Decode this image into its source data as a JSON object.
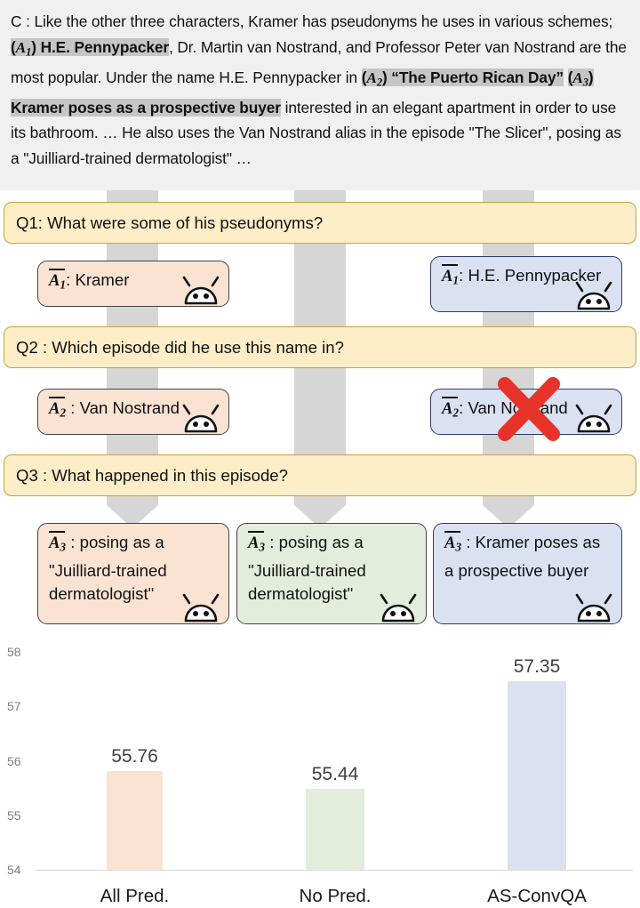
{
  "context": {
    "label": "C :",
    "parts": [
      {
        "t": " Like the other three characters, Kramer has pseudonyms he uses in various schemes; ",
        "hl": false,
        "b": false
      },
      {
        "t": "(A₁) H.E. Pennypacker",
        "hl": true,
        "b": true,
        "math": "A",
        "subscript": "1"
      },
      {
        "t": ", Dr. Martin van Nostrand, and Professor Peter van Nostrand are the most popular. Under the name H.E. Pennypacker in ",
        "hl": false,
        "b": false
      },
      {
        "t": "(A₂) “The Puerto Rican Day”",
        "hl": true,
        "b": true,
        "math": "A",
        "subscript": "2"
      },
      {
        "t": " ",
        "hl": false,
        "b": false
      },
      {
        "t": "(A₃) Kramer poses as a prospective buyer",
        "hl": true,
        "b": true,
        "math": "A",
        "subscript": "3"
      },
      {
        "t": " interested in an elegant apartment in order to use its bathroom. … He also uses the Van Nostrand alias in the episode \"The Slicer\", posing as a \"Juilliard-trained dermatologist\" …",
        "hl": false,
        "b": false
      }
    ],
    "full_text": "C : Like the other three characters, Kramer has pseudonyms he uses in various schemes; (A1) H.E. Pennypacker, Dr. Martin van Nostrand, and Professor Peter van Nostrand are the most popular. Under the name H.E. Pennypacker in (A2) “The Puerto Rican Day” (A3) Kramer poses as a prospective buyer interested in an elegant apartment in order to use its bathroom. … He also uses the Van Nostrand alias in the episode \"The Slicer\", posing as a \"Juilliard-trained dermatologist\" …"
  },
  "turns": [
    {
      "question": "Q1: What were some of his pseudonyms?",
      "answers": [
        {
          "prefix": "A",
          "sub": "1",
          "sep": ":",
          "text": "Kramer",
          "color": "peach",
          "error": false
        },
        {
          "prefix": "A",
          "sub": "1",
          "sep": ":",
          "text": "H.E. Pennypacker",
          "color": "blue",
          "error": false
        }
      ]
    },
    {
      "question": "Q2 : Which episode did he use this name in?",
      "answers": [
        {
          "prefix": "A",
          "sub": "2",
          "sep": " :",
          "text": "Van Nostrand",
          "color": "peach",
          "error": false
        },
        {
          "prefix": "A",
          "sub": "2",
          "sep": ":",
          "text": "Van Nostrand",
          "color": "blue",
          "error": true
        }
      ]
    },
    {
      "question": "Q3 : What happened in this episode?",
      "answers": [
        {
          "prefix": "A",
          "sub": "3",
          "sep": " :",
          "text": "posing as a \"Juilliard-trained dermatologist\"",
          "color": "peach",
          "error": false
        },
        {
          "prefix": "A",
          "sub": "3",
          "sep": " :",
          "text": "posing as a \"Juilliard-trained dermatologist\"",
          "color": "green",
          "error": false
        },
        {
          "prefix": "A",
          "sub": "3",
          "sep": " :",
          "text": "Kramer poses as a prospective buyer",
          "color": "blue",
          "error": false
        }
      ]
    }
  ],
  "icons": {
    "android": "android-robot-icon",
    "error_mark": "red-x-icon"
  },
  "colors": {
    "context_bg": "#f0f0f0",
    "highlight": "#c6c6c6",
    "question_bg": "#fdeec8",
    "question_border": "#c8a23a",
    "peach": "#fae3d3",
    "green": "#e2eedb",
    "blue": "#dae1f1",
    "band_gray": "#d6d6d6",
    "error_red": "#e8332a"
  },
  "chart_data": {
    "type": "bar",
    "title": "",
    "xlabel": "",
    "ylabel": "",
    "categories": [
      "All Pred.",
      "No Pred.",
      "AS-ConvQA"
    ],
    "values": [
      55.76,
      55.44,
      57.35
    ],
    "value_labels": [
      "55.76",
      "55.44",
      "57.35"
    ],
    "bar_colors": [
      "#fae3d3",
      "#e2eedb",
      "#dae1f1"
    ],
    "ylim": [
      54,
      58
    ],
    "yticks": [
      54,
      55,
      56,
      57,
      58
    ],
    "ytick_labels": [
      "54",
      "55",
      "56",
      "57",
      "58"
    ],
    "grid": false,
    "legend": "none"
  }
}
